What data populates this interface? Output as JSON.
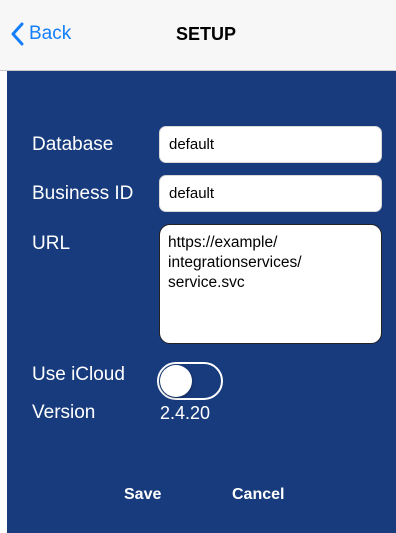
{
  "nav": {
    "back_label": "Back",
    "title": "SETUP"
  },
  "form": {
    "database_label": "Database",
    "database_value": "default",
    "business_id_label": "Business ID",
    "business_id_value": "default",
    "url_label": "URL",
    "url_value": "https://example/\nintegrationservices/\nservice.svc",
    "icloud_label": "Use iCloud",
    "icloud_enabled": false,
    "version_label": "Version",
    "version_value": "2.4.20"
  },
  "actions": {
    "save_label": "Save",
    "cancel_label": "Cancel"
  },
  "colors": {
    "panel_background": "#183b7d",
    "accent": "#147efb",
    "navbar_background": "#f7f7f7"
  },
  "icons": {
    "back": "chevron-left-icon"
  }
}
